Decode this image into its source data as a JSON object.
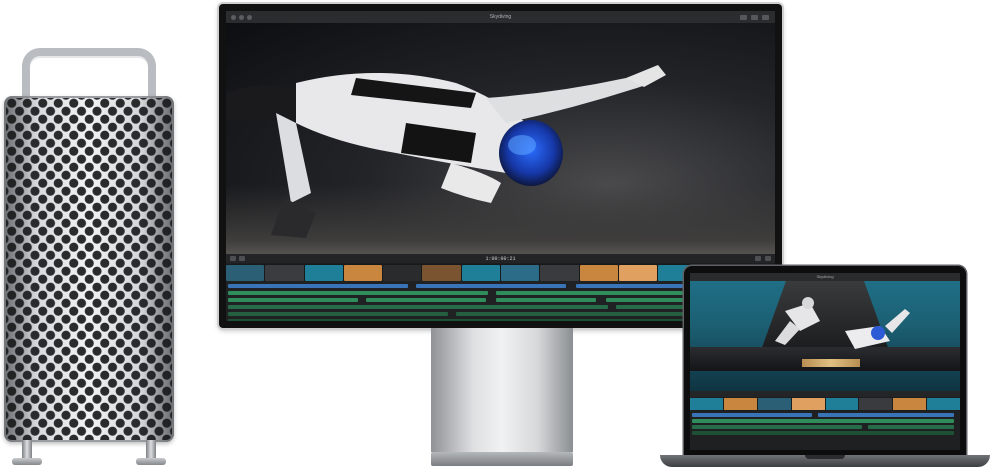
{
  "display": {
    "window_title": "Skydiving",
    "timecode": "1:00:00:21"
  },
  "laptop": {
    "window_title": "Skydiving"
  },
  "colors": {
    "teal_clip": "#1f7e98",
    "blue_track": "#3a74b8",
    "green_track": "#2f8d5b",
    "orange_clip": "#c9863f"
  }
}
